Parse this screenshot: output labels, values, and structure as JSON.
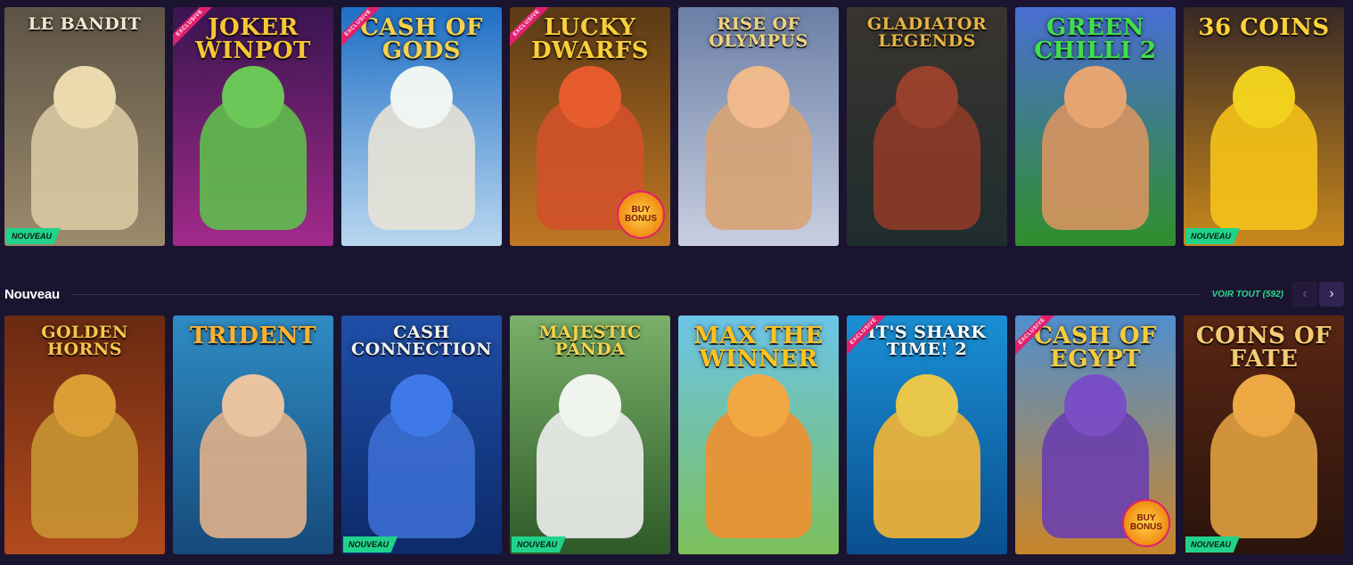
{
  "featured_row": [
    {
      "title": "LE BANDIT",
      "exclusive": false,
      "new": true,
      "buy_bonus": false,
      "bg_top": "#5d5346",
      "bg_bottom": "#9c8a6c",
      "hero": "#d9c9a2",
      "logo_color": "#f1e6cf",
      "logo_size": "small"
    },
    {
      "title": "JOKER WINPOT",
      "exclusive": true,
      "new": false,
      "buy_bonus": false,
      "bg_top": "#3a1550",
      "bg_bottom": "#a12a8a",
      "hero": "#5fbe4c",
      "logo_color": "#f7c733",
      "logo_size": ""
    },
    {
      "title": "CASH OF GODS",
      "exclusive": true,
      "new": false,
      "buy_bonus": false,
      "bg_top": "#1f6fc5",
      "bg_bottom": "#b9d7f0",
      "hero": "#e8e3d6",
      "logo_color": "#f6d24b",
      "logo_size": ""
    },
    {
      "title": "LUCKY DWARFS",
      "exclusive": true,
      "new": false,
      "buy_bonus": true,
      "bg_top": "#5b3a16",
      "bg_bottom": "#c07822",
      "hero": "#d2522a",
      "logo_color": "#f8cf3a",
      "logo_size": ""
    },
    {
      "title": "RISE OF OLYMPUS",
      "exclusive": false,
      "new": false,
      "buy_bonus": false,
      "bg_top": "#6b7fa6",
      "bg_bottom": "#c8cfe0",
      "hero": "#d9a475",
      "logo_color": "#f2d37a",
      "logo_size": "small"
    },
    {
      "title": "GLADIATOR LEGENDS",
      "exclusive": false,
      "new": false,
      "buy_bonus": false,
      "bg_top": "#3a3530",
      "bg_bottom": "#1f2c2e",
      "hero": "#8f3a28",
      "logo_color": "#e8b341",
      "logo_size": "small"
    },
    {
      "title": "GREEN CHILLI 2",
      "exclusive": false,
      "new": false,
      "buy_bonus": false,
      "bg_top": "#4a6fd4",
      "bg_bottom": "#2f8f2a",
      "hero": "#d89460",
      "logo_color": "#3fe04a",
      "logo_size": ""
    },
    {
      "title": "36 COINS",
      "exclusive": false,
      "new": true,
      "buy_bonus": false,
      "bg_top": "#3a2a26",
      "bg_bottom": "#c9881c",
      "hero": "#f6c21a",
      "logo_color": "#ffd23a",
      "logo_size": ""
    }
  ],
  "section": {
    "title": "Nouveau",
    "see_all": "VOIR TOUT (592)",
    "prev_icon": "‹",
    "next_icon": "›"
  },
  "new_row": [
    {
      "title": "GOLDEN HORNS",
      "exclusive": false,
      "new": false,
      "buy_bonus": false,
      "bg_top": "#6a2a12",
      "bg_bottom": "#b24a1c",
      "hero": "#c79432",
      "logo_color": "#f4c64c",
      "logo_size": "small"
    },
    {
      "title": "TRIDENT",
      "exclusive": false,
      "new": false,
      "buy_bonus": false,
      "bg_top": "#2f8cc4",
      "bg_bottom": "#164a7a",
      "hero": "#e0b18a",
      "logo_color": "#ffb12e",
      "logo_size": ""
    },
    {
      "title": "CASH CONNECTION",
      "exclusive": false,
      "new": true,
      "buy_bonus": false,
      "bg_top": "#1f4fa8",
      "bg_bottom": "#0d2a6a",
      "hero": "#3b6ed2",
      "logo_color": "#f2f2f2",
      "logo_size": "small"
    },
    {
      "title": "MAJESTIC PANDA",
      "exclusive": false,
      "new": true,
      "buy_bonus": false,
      "bg_top": "#7ab06a",
      "bg_bottom": "#2e5a28",
      "hero": "#eeeeee",
      "logo_color": "#f4d44c",
      "logo_size": "small"
    },
    {
      "title": "MAX THE WINNER",
      "exclusive": false,
      "new": false,
      "buy_bonus": false,
      "bg_top": "#6cc4e8",
      "bg_bottom": "#7cc05a",
      "hero": "#f09030",
      "logo_color": "#ffc21e",
      "logo_size": ""
    },
    {
      "title": "IT'S SHARK TIME! 2",
      "exclusive": true,
      "new": false,
      "buy_bonus": false,
      "bg_top": "#1a8fd4",
      "bg_bottom": "#0a4f8f",
      "hero": "#f4b536",
      "logo_color": "#ffffff",
      "logo_size": "small"
    },
    {
      "title": "CASH OF EGYPT",
      "exclusive": true,
      "new": false,
      "buy_bonus": true,
      "bg_top": "#4f8fd0",
      "bg_bottom": "#c9862a",
      "hero": "#6a3fb0",
      "logo_color": "#f5cc3c",
      "logo_size": ""
    },
    {
      "title": "COINS OF FATE",
      "exclusive": false,
      "new": true,
      "buy_bonus": false,
      "bg_top": "#5a2614",
      "bg_bottom": "#2a140c",
      "hero": "#e0a040",
      "logo_color": "#f5cc74",
      "logo_size": ""
    }
  ],
  "labels": {
    "exclusive": "EXCLUSIVE",
    "new": "NOUVEAU",
    "buy_bonus": "BUY BONUS"
  }
}
